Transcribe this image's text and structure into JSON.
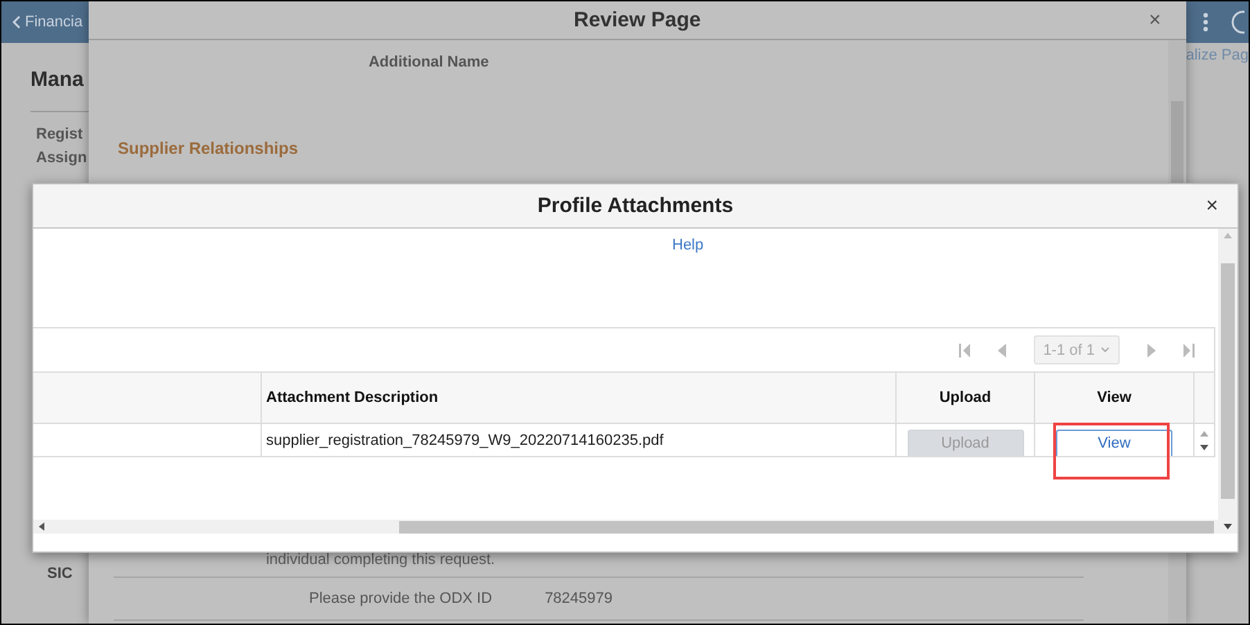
{
  "background_page": {
    "back_link": "Financia",
    "title": "Mana",
    "menu_items": [
      "Regist",
      "Assign"
    ],
    "section_label": "SIC",
    "link": "alize Pag"
  },
  "review_page": {
    "title": "Review Page",
    "close_label": "×",
    "field_label": "Additional Name",
    "section_title": "Supplier Relationships",
    "note": "individual completing this request.",
    "field": {
      "label": "Please provide the ODX ID",
      "value": "78245979"
    }
  },
  "dialog": {
    "title": "Profile Attachments",
    "close_label": "×",
    "help_link": "Help",
    "pager": {
      "range": "1-1 of 1"
    },
    "columns": [
      "Attachment Description",
      "Upload",
      "View"
    ],
    "rows": [
      {
        "description": "supplier_registration_78245979_W9_20220714160235.pdf",
        "upload": {
          "label": "Upload",
          "disabled": true
        },
        "view": {
          "label": "View",
          "disabled": false,
          "highlighted": true
        }
      }
    ]
  }
}
